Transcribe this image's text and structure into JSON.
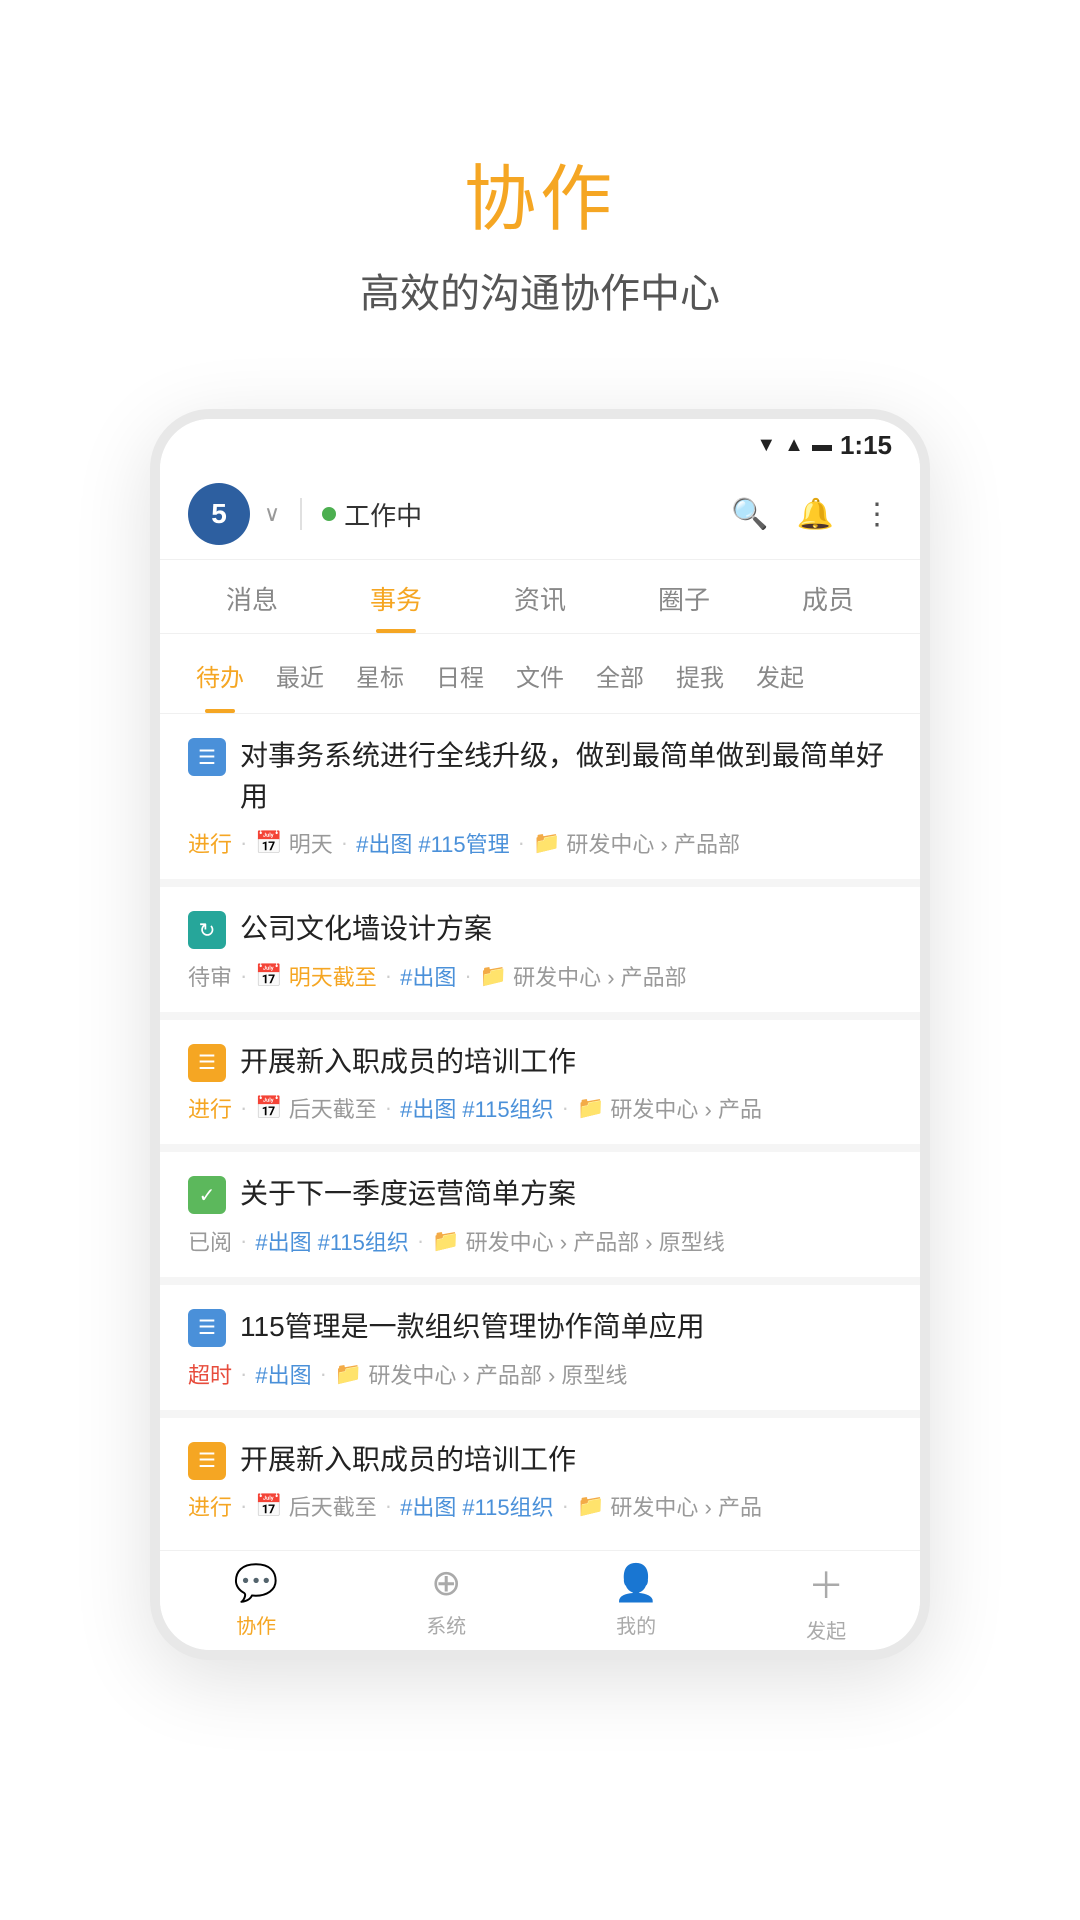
{
  "hero": {
    "title": "协作",
    "subtitle": "高效的沟通协作中心"
  },
  "status_bar": {
    "time": "1:15"
  },
  "header": {
    "avatar_number": "5",
    "chevron": "∨",
    "status_text": "工作中",
    "search_label": "搜索",
    "bell_label": "通知",
    "more_label": "更多"
  },
  "nav_tabs": [
    {
      "label": "消息",
      "active": false
    },
    {
      "label": "事务",
      "active": true
    },
    {
      "label": "资讯",
      "active": false
    },
    {
      "label": "圈子",
      "active": false
    },
    {
      "label": "成员",
      "active": false
    }
  ],
  "sub_tabs": [
    {
      "label": "待办",
      "active": true
    },
    {
      "label": "最近",
      "active": false
    },
    {
      "label": "星标",
      "active": false
    },
    {
      "label": "日程",
      "active": false
    },
    {
      "label": "文件",
      "active": false
    },
    {
      "label": "全部",
      "active": false
    },
    {
      "label": "提我",
      "active": false
    },
    {
      "label": "发起",
      "active": false
    }
  ],
  "tasks": [
    {
      "id": 1,
      "icon_type": "blue",
      "icon_char": "≡",
      "title": "对事务系统进行全线升级，做到最简单做到最简单好用",
      "status": "进行",
      "status_type": "in-progress",
      "deadline": "明天",
      "deadline_warn": false,
      "tags": [
        "#出图",
        "#115管理"
      ],
      "path": "研发中心 › 产品部"
    },
    {
      "id": 2,
      "icon_type": "teal",
      "icon_char": "⟳",
      "title": "公司文化墙设计方案",
      "status": "待审",
      "status_type": "pending",
      "deadline": "明天截至",
      "deadline_warn": true,
      "tags": [
        "#出图"
      ],
      "path": "研发中心 › 产品部"
    },
    {
      "id": 3,
      "icon_type": "orange",
      "icon_char": "≡",
      "title": "开展新入职成员的培训工作",
      "status": "进行",
      "status_type": "in-progress",
      "deadline": "后天截至",
      "deadline_warn": false,
      "tags": [
        "#出图",
        "#115组织"
      ],
      "path": "研发中心 › 产品"
    },
    {
      "id": 4,
      "icon_type": "green",
      "icon_char": "✓",
      "title": "关于下一季度运营简单方案",
      "status": "已阅",
      "status_type": "read",
      "deadline": "",
      "deadline_warn": false,
      "tags": [
        "#出图",
        "#115组织"
      ],
      "path": "研发中心 › 产品部 › 原型线"
    },
    {
      "id": 5,
      "icon_type": "blue",
      "icon_char": "≡",
      "title": "115管理是一款组织管理协作简单应用",
      "status": "超时",
      "status_type": "overdue",
      "deadline": "",
      "deadline_warn": false,
      "tags": [
        "#出图"
      ],
      "path": "研发中心 › 产品部 › 原型线"
    },
    {
      "id": 6,
      "icon_type": "orange",
      "icon_char": "≡",
      "title": "开展新入职成员的培训工作",
      "status": "进行",
      "status_type": "in-progress",
      "deadline": "后天截至",
      "deadline_warn": false,
      "tags": [
        "#出图",
        "#115组织"
      ],
      "path": "研发中心 › 产品"
    }
  ],
  "bottom_nav": [
    {
      "label": "协作",
      "icon": "💬",
      "active": true
    },
    {
      "label": "系统",
      "icon": "⊕",
      "active": false
    },
    {
      "label": "我的",
      "icon": "👤",
      "active": false
    },
    {
      "label": "发起",
      "icon": "+",
      "active": false
    }
  ]
}
